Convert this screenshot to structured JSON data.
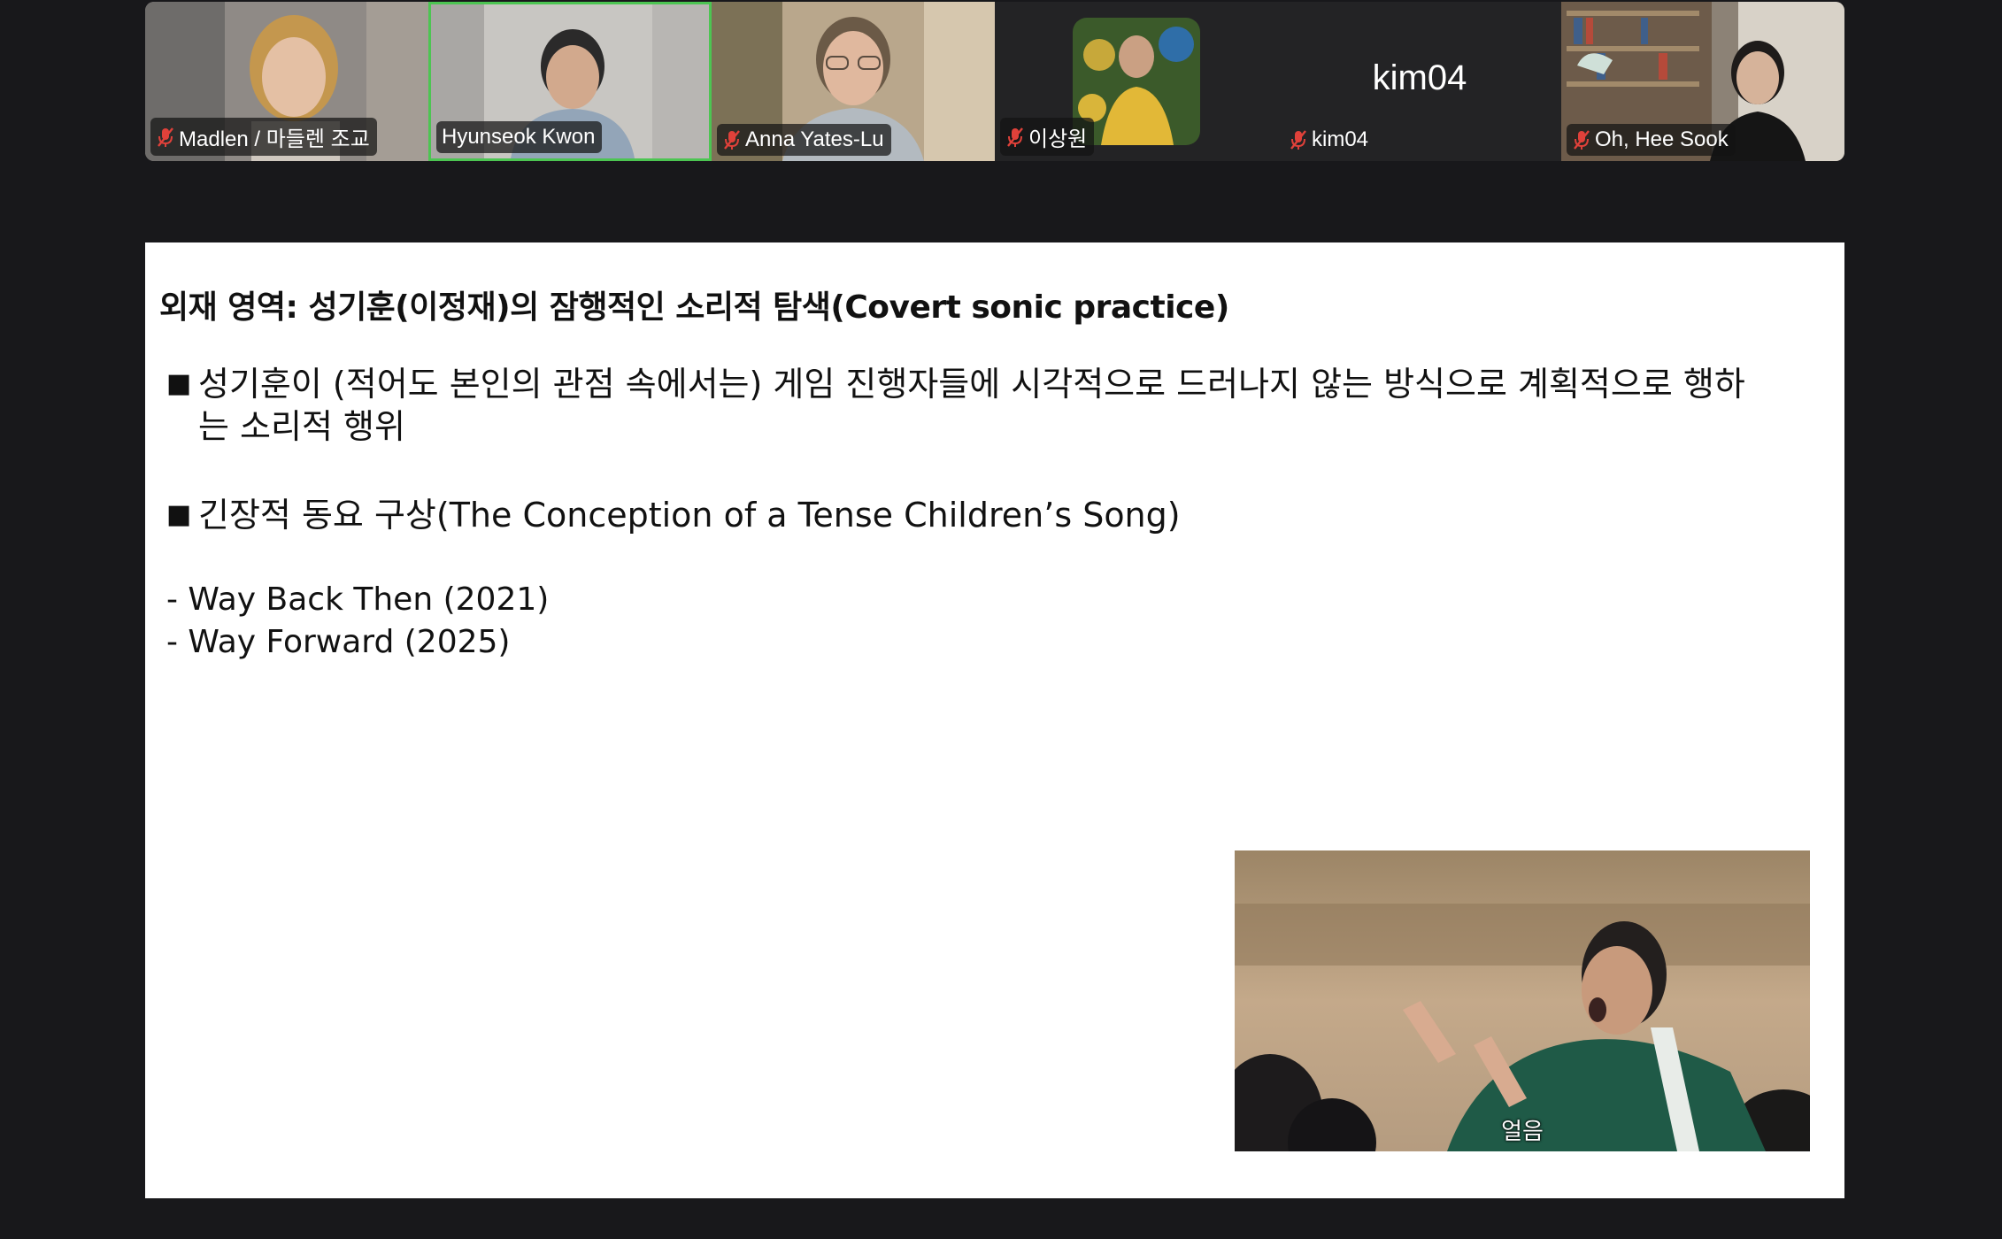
{
  "participants": [
    {
      "name": "Madlen / 마들렌 조교",
      "muted": true
    },
    {
      "name": "Hyunseok Kwon",
      "muted": false,
      "active": true
    },
    {
      "name": "Anna Yates-Lu",
      "muted": true
    },
    {
      "name": "이상원",
      "muted": true
    },
    {
      "name": "kim04",
      "muted": true,
      "video_off_label": "kim04"
    },
    {
      "name": "Oh, Hee Sook",
      "muted": true
    }
  ],
  "slide": {
    "title": "외재 영역: 성기훈(이정재)의 잠행적인 소리적 탐색(Covert sonic practice)",
    "bullets": [
      {
        "marker": "■",
        "text": "성기훈이 (적어도 본인의 관점 속에서는) 게임 진행자들에 시각적으로 드러나지 않는 방식으로 계획적으로 행하는 소리적 행위"
      },
      {
        "marker": "■",
        "text": "긴장적 동요 구상(The Conception of a Tense Children’s Song)"
      }
    ],
    "sub_items": [
      "- Way Back Then (2021)",
      "- Way Forward (2025)"
    ],
    "video_caption": "얼음"
  },
  "colors": {
    "background": "#18181b",
    "active_speaker_border": "#4cc552",
    "mute_icon": "#e0413a"
  }
}
